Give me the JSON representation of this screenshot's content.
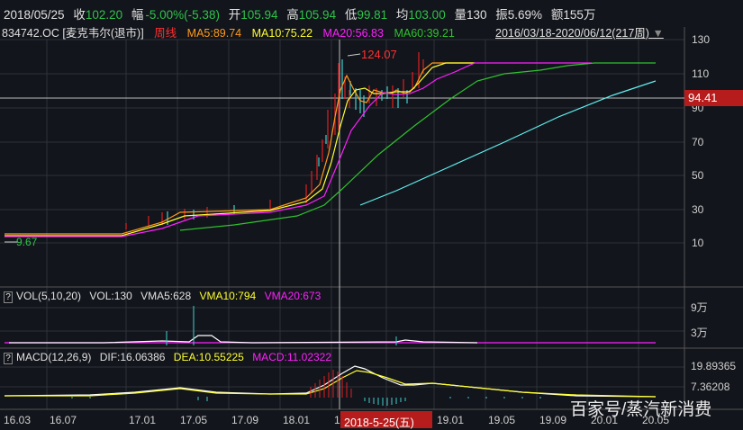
{
  "quote": {
    "date": "2018/05/25",
    "close_label": "收",
    "close": "102.20",
    "change_label": "幅",
    "change": "-5.00%(-5.38)",
    "open_label": "开",
    "open": "105.94",
    "high_label": "高",
    "high": "105.94",
    "low_label": "低",
    "low": "99.81",
    "avg_label": "均",
    "avg": "103.00",
    "vol_label": "量",
    "vol": "130",
    "amp_label": "振",
    "amp": "5.69%",
    "amount_label": "额",
    "amount": "155万"
  },
  "header": {
    "code": "834742.OC [麦克韦尔(退市)]",
    "period": "周线",
    "ma5": "MA5:89.74",
    "ma10": "MA10:75.22",
    "ma20": "MA20:56.83",
    "ma60": "MA60:39.21",
    "range": "2016/03/18-2020/06/12(217周)"
  },
  "price_axis": [
    "130",
    "110",
    "90",
    "70",
    "50",
    "30",
    "10"
  ],
  "current_price": "94.41",
  "high_marker": "124.07",
  "low_marker": "9.67",
  "volume": {
    "q": "?",
    "title": "VOL(5,10,20)",
    "vol": "VOL:130",
    "vma5": "VMA5:628",
    "vma10": "VMA10:794",
    "vma20": "VMA20:673",
    "axis": [
      "9万",
      "3万"
    ]
  },
  "macd": {
    "q": "?",
    "title": "MACD(12,26,9)",
    "dif": "DIF:16.06386",
    "dea": "DEA:10.55225",
    "macd": "MACD:11.02322",
    "axis": [
      "19.89365",
      "7.36208"
    ]
  },
  "date_axis": [
    "16.03",
    "16.07",
    "17.01",
    "17.05",
    "17.09",
    "18.01",
    "1",
    "19.01",
    "19.05",
    "19.09",
    "20.01",
    "20.05"
  ],
  "cursor_date": "2018-5-25(五)",
  "watermark": "百家号/蒸汽新消费",
  "colors": {
    "up": "#e02020",
    "down": "#40d0d0",
    "ma5": "#ff9a1a",
    "ma10": "#ffff30",
    "ma20": "#ff20ff",
    "ma60": "#2fc22f",
    "ma120": "#60f0f0"
  }
}
